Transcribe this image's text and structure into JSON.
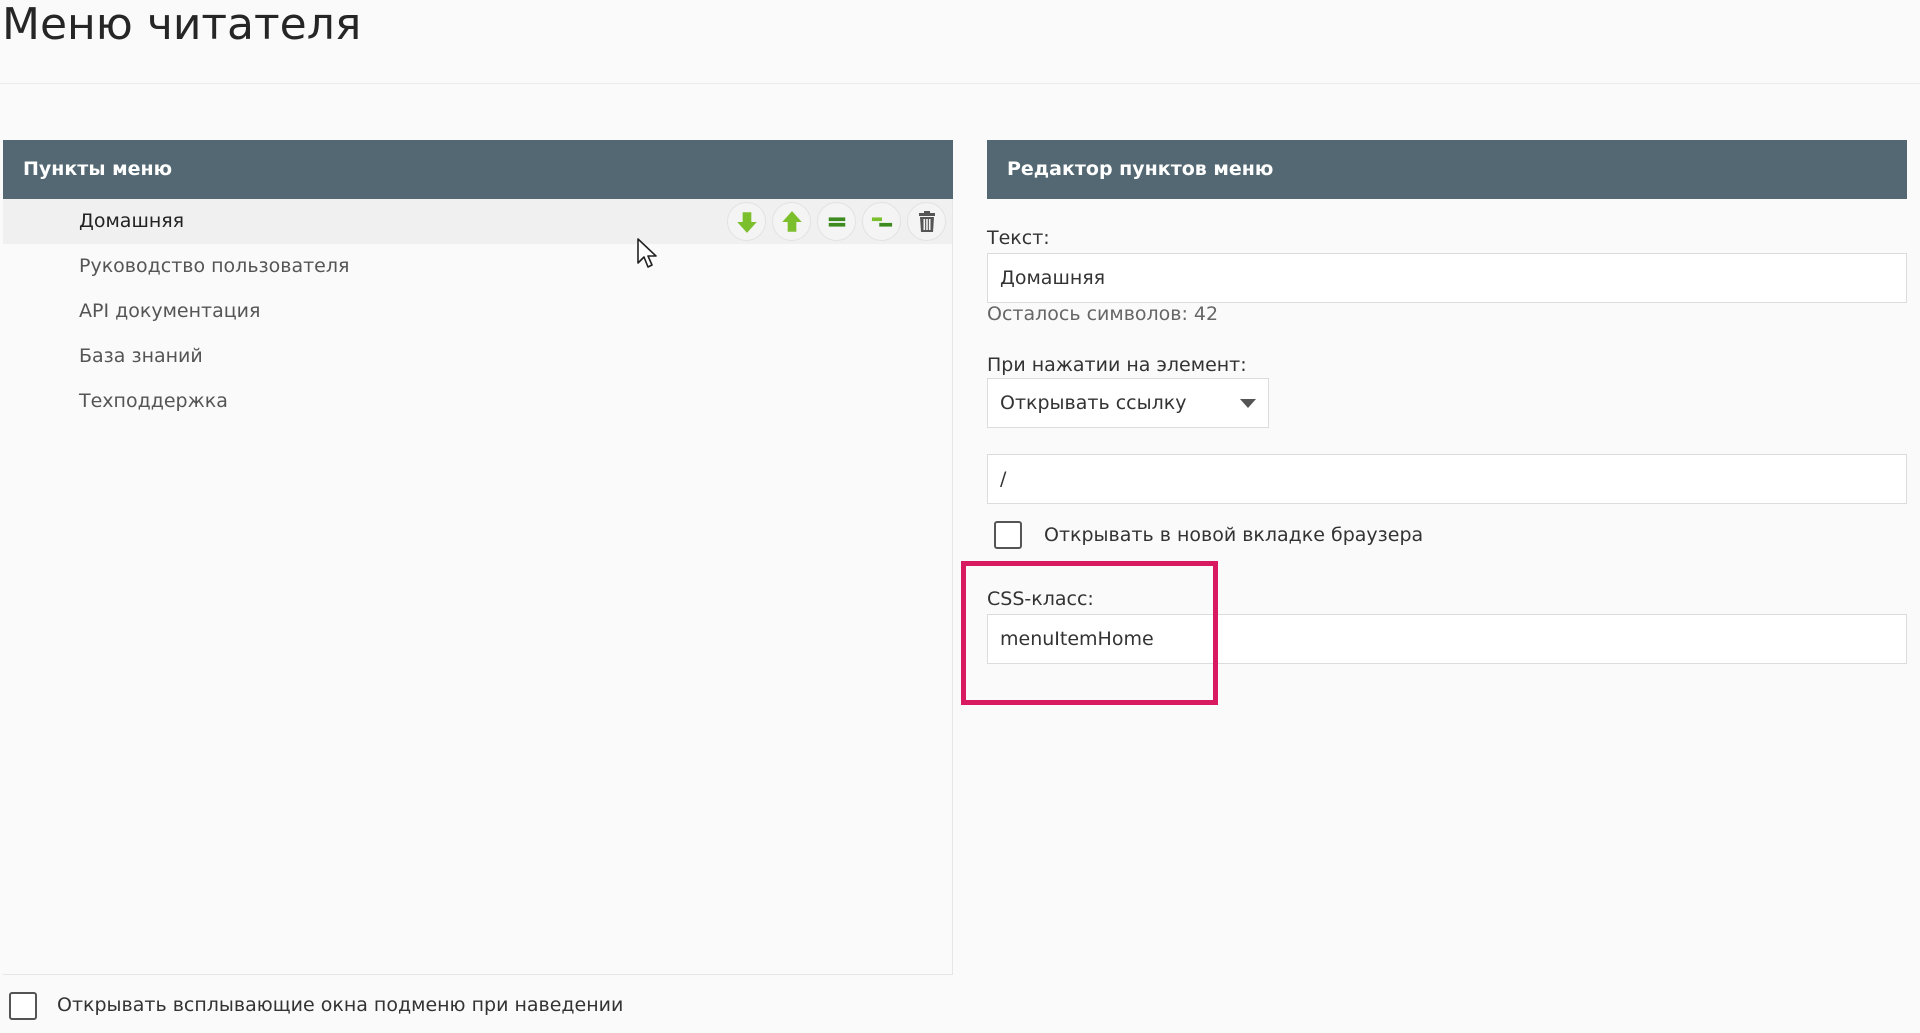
{
  "page": {
    "title": "Меню читателя"
  },
  "left_panel": {
    "header": "Пункты меню",
    "items": [
      {
        "label": "Домашняя"
      },
      {
        "label": "Руководство пользователя"
      },
      {
        "label": "API документация"
      },
      {
        "label": "База знаний"
      },
      {
        "label": "Техподдержка"
      }
    ],
    "actions": [
      "arrow-down-icon",
      "arrow-up-icon",
      "equal-icon",
      "outdent-icon",
      "trash-icon"
    ],
    "submenu_hover_label": "Открывать всплывающие окна подменю при наведении"
  },
  "editor": {
    "header": "Редактор пунктов меню",
    "text_label": "Текст:",
    "text_value": "Домашняя",
    "chars_left": "Осталось символов: 42",
    "click_label": "При нажатии на элемент:",
    "click_action": "Открывать ссылку",
    "link_value": "/",
    "new_tab_label": "Открывать в новой вкладке браузера",
    "css_label": "CSS-класс:",
    "css_value": "menuItemHome"
  },
  "colors": {
    "header_bg": "#536872",
    "icon_green": "#7cbf2c",
    "icon_dark_green": "#3d8b1f",
    "highlight": "#d81b60"
  }
}
